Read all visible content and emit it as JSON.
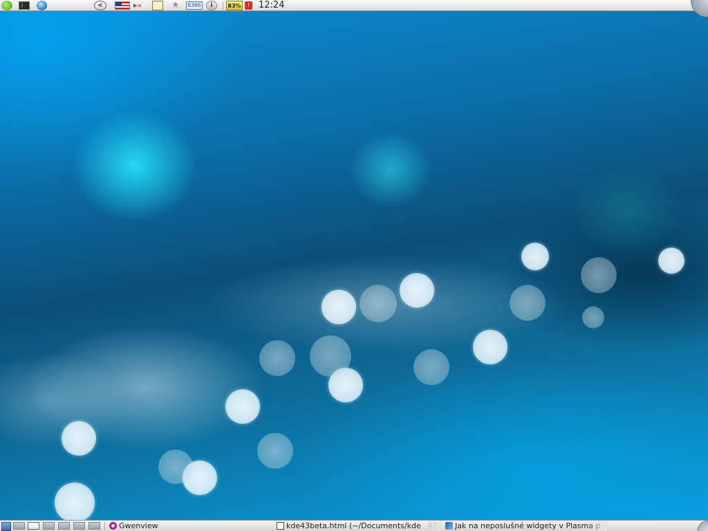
{
  "top_panel": {
    "kickoff_icon": "kde-kickoff-icon",
    "terminal_icon": "terminal-icon",
    "browser_icon": "globe-icon",
    "back_icon": "chevron-left-icon",
    "back_glyph": "<",
    "keyboard_layout_icon": "us-flag-icon",
    "volume_icon": "speaker-muted-icon",
    "clipboard_icon": "clipboard-icon",
    "star_icon": "star-icon",
    "counter_value": "6366",
    "info_icon": "info-icon",
    "info_glyph": "i",
    "battery_percent": "83%",
    "alert_icon": "alert-icon",
    "clock_time": "12:24"
  },
  "bottom_panel": {
    "show_desktop_icon": "show-desktop-icon",
    "pager": {
      "desktops": 7,
      "active_index": 1
    },
    "tasks": [
      {
        "icon": "gwenview-icon",
        "title": "Gwenview"
      },
      {
        "icon": "document-icon",
        "title": "kde43beta.html (~/Documents/kde",
        "extra": "43"
      },
      {
        "icon": "browser-icon",
        "title": "Jak na neposlušné widgety v Plasma p"
      }
    ]
  },
  "wallpaper": {
    "colors": {
      "base": "#0a6fa8",
      "highlight_cyan": "#28ebff",
      "bokeh": "#e8f6fc"
    }
  }
}
